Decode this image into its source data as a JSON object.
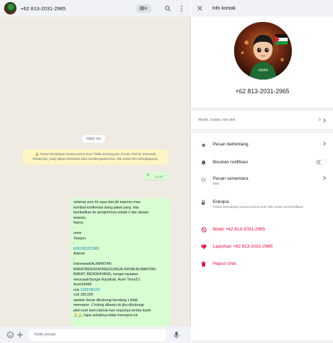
{
  "chat": {
    "header": {
      "name": "+62 813-2031-2965"
    },
    "date_label": "HARI INI",
    "encryption_note": "🔒 Pesan terenkripsi secara end-to-end. Tidak seorang pun di luar chat ini, termasuk WhatsApp, yang dapat membaca atau mendengarkannya. Klik untuk info selengkapnya.",
    "msg1": {
      "prefix": "P",
      "time": "14.20",
      "ticks": "✓"
    },
    "msg2": {
      "lines": [
        "selamat sore kk saya dari j&t express mau",
        "kembali konfirmasi ulang paket yang  kita",
        "kembalikan ke pengirimnya sebab // dan alasan",
        "tertentu",
        "Nama",
        ":",
        "umar",
        "Telepon",
        ":"
      ],
      "phone_link": "6281320312965",
      "lines2": [
        "Alamat",
        ":",
        "IndonesiaKALIMANTAN",
        "BARATBENGKAYANGSUNGAI RAYAKALIMANTAN",
        "BARAT, BENGKAYANG, sungai rayaaiue",
        "meurasahSungai RayaKab. Aceh TimurD.I.",
        "Aceh24458"
      ],
      "resi_label": "resi ",
      "resi_link": "1203795107",
      "lines3": [
        "cod 180.000",
        "apakah benar dihubungi berulang x tidak",
        "merespon  // tolong dibantu kk jika dihubungi",
        "pleh kurir kami dahulu kan responya terima kasih",
        "🙏🙏 //apa sebabnya tidak merespon kk"
      ],
      "time": "14.21",
      "ticks": "✓"
    },
    "composer": {
      "placeholder": "Ketik pesan"
    }
  },
  "info": {
    "title": "Info kontak",
    "phone": "+62 813-2031-2965",
    "avatar_caption": "UMAR",
    "media": {
      "label": "Media, tautan, dan dok",
      "count": "0"
    },
    "options": {
      "starred": "Pesan berbintang",
      "mute": "Bisukan notifikasi",
      "disappearing": "Pesan sementara",
      "disappearing_sub": "Mati",
      "encryption": "Enkripsi",
      "encryption_sub": "Pesan terenkripsi secara end-to-end. Klik untuk memverifikasi.",
      "block": "Blokir +62 813-2031-2965",
      "report": "Laporkan +62 813-2031-2965",
      "delete": "Hapus chat"
    }
  },
  "colors": {
    "outgoing_bubble": "#d9fdd3",
    "chat_background": "#efeae2",
    "danger": "#ea0038",
    "link": "#027eb5",
    "read_tick": "#53bdeb"
  }
}
